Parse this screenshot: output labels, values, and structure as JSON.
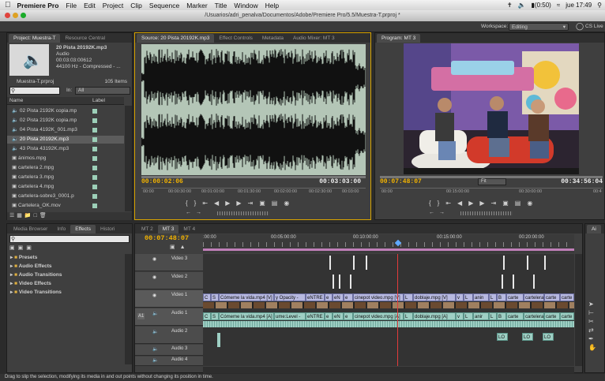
{
  "menubar": {
    "app": "Premiere Pro",
    "items": [
      "File",
      "Edit",
      "Project",
      "Clip",
      "Sequence",
      "Marker",
      "Title",
      "Window",
      "Help"
    ],
    "battery": "(0:50)",
    "clock": "jue 17:49"
  },
  "window": {
    "title": "/Usuarios/adri_penalva/Documentos/Adobe/Premiere Pro/5.5/Muestra-T.prproj *"
  },
  "workspace": {
    "label": "Workspace:",
    "value": "Editing",
    "cs_live": "CS Live"
  },
  "project": {
    "tabs": [
      "Project: Muestra-T",
      "Resource Central"
    ],
    "clip_name": "20 Pista 20192K.mp3",
    "clip_type": "Audio",
    "clip_duration": "00:03:03:00612",
    "clip_info": "44100 Hz - Compressed - ...",
    "file": "Muestra-T.prproj",
    "count": "105 Items",
    "in_label": "In:",
    "in_value": "All",
    "search_placeholder": "",
    "col_name": "Name",
    "col_label": "Label",
    "items": [
      "02 Pista 2192K copia.mp",
      "02 Pista 2192K copia.mp",
      "04 Pista 4192K_001.mp3",
      "20 Pista 20192K.mp3",
      "43 Pista 43192K.mp3",
      "ánimos.mpg",
      "cartelera 2.mpg",
      "cartelera 3.mpg",
      "cartelera 4.mpg",
      "cartelera-sobre3_0001.p",
      "Cartelera_OK.mov"
    ]
  },
  "source": {
    "tabs": [
      "Source: 20 Pista 20192K.mp3",
      "Effect Controls",
      "Metadata",
      "Audio Mixer: MT 3"
    ],
    "tc_left": "00:00:02:06",
    "tc_right": "00:03:03:00",
    "ruler": [
      "00:00",
      "00:00:30:00",
      "00:01:00:00",
      "00:01:30:00",
      "00:02:00:00",
      "00:02:30:00",
      "00:03:00"
    ]
  },
  "program": {
    "tab": "Program: MT 3",
    "tc_left": "00:07:48:07",
    "fit": "Fit",
    "tc_right": "00:34:56:04",
    "ruler": [
      "00:00",
      "00:15:00:00",
      "00:30:00:00",
      "00:4"
    ]
  },
  "media": {
    "tabs": [
      "Media Browser",
      "Info",
      "Effects",
      "Histori"
    ],
    "items": [
      "Presets",
      "Audio Effects",
      "Audio Transitions",
      "Video Effects",
      "Video Transitions"
    ]
  },
  "timeline": {
    "tabs": [
      "MT 2",
      "MT 3",
      "MT 4"
    ],
    "tc": "00:07:48:07",
    "ruler": [
      ":00:00",
      "00:05:00:00",
      "00:10:00:00",
      "00:15:00:00",
      "00:20:00:00"
    ],
    "tracks": [
      "Video 3",
      "Video 2",
      "Video 1",
      "Audio 1",
      "Audio 2",
      "Audio 3",
      "Audio 4"
    ],
    "a1": "A1",
    "vclips": [
      "C",
      "S",
      "Cómeme la vida.mp4 [V]",
      "y Opacity -",
      "eNTRE",
      "e",
      "eN",
      "e",
      "cinepot video.mpg [V]",
      "L",
      "doblaje.mpg [V]",
      "v",
      "L",
      "anin",
      "L",
      "B",
      "carte",
      "cartelera",
      "carte",
      "carte"
    ],
    "aclips": [
      "C",
      "S",
      "Cómeme la vida.mp4 [A]",
      "ume:Level -",
      "eNTRE",
      "e",
      "eN",
      "e",
      "cinepot video.mpg [A]",
      "L",
      "doblaje.mpg [A]",
      "v",
      "L",
      "anir",
      "L",
      "B",
      "carte",
      "cartelera",
      "carte",
      "carte"
    ],
    "a2clips": [
      "LO",
      "LO",
      "LO"
    ]
  },
  "tools": {
    "tab": "Ai"
  },
  "status": "Drag to slip the selection, modifying its media in and out points without changing its position in time."
}
